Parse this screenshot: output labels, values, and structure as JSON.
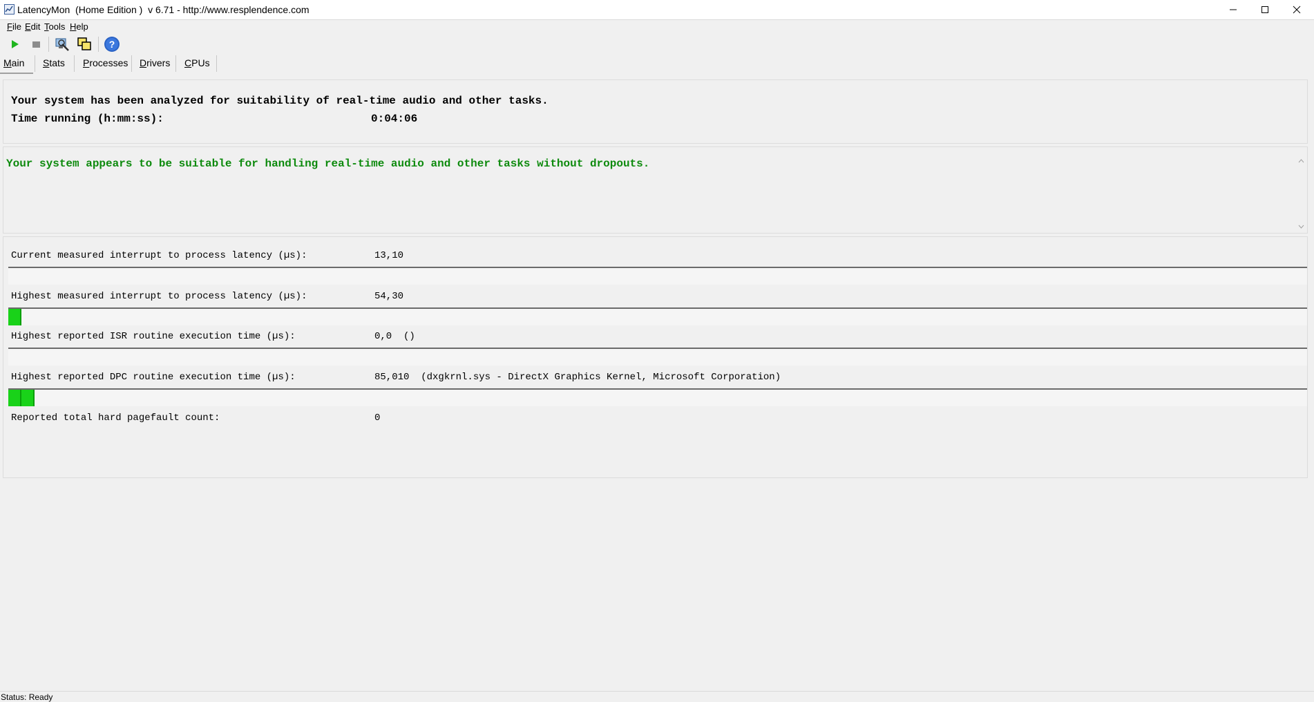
{
  "window": {
    "title": "LatencyMon  (Home Edition )  v 6.71 - http://www.resplendence.com"
  },
  "menu": [
    {
      "underline": "F",
      "rest": "ile"
    },
    {
      "underline": "E",
      "rest": "dit"
    },
    {
      "underline": "T",
      "rest": "ools"
    },
    {
      "underline": "H",
      "rest": "elp"
    }
  ],
  "toolbar": {
    "icons": [
      "play-icon",
      "stop-icon",
      "analyze-icon",
      "copy-windows-icon",
      "help-icon"
    ]
  },
  "tabs": [
    {
      "underline": "M",
      "rest": "ain"
    },
    {
      "underline": "S",
      "rest": "tats"
    },
    {
      "underline": "P",
      "rest": "rocesses"
    },
    {
      "underline": "D",
      "rest": "rivers"
    },
    {
      "underline": "C",
      "rest": "PUs"
    }
  ],
  "summary": {
    "headline": "Your system has been analyzed for suitability of real-time audio and other tasks.",
    "time_label": "Time running (h:mm:ss):",
    "time_value": "0:04:06"
  },
  "verdict": {
    "text": "Your system appears to be suitable for handling real-time audio and other tasks without dropouts."
  },
  "metrics": {
    "current_latency": {
      "label": "Current measured interrupt to process latency (µs):",
      "value": "13,10",
      "bar_fraction": 0
    },
    "highest_latency": {
      "label": "Highest measured interrupt to process latency (µs):",
      "value": "54,30",
      "bar_fraction": 0.01
    },
    "isr": {
      "label": "Highest reported ISR routine execution time (µs):",
      "value": "0,0  ()",
      "bar_fraction": 0
    },
    "dpc": {
      "label": "Highest reported DPC routine execution time (µs):",
      "value": "85,010  (dxgkrnl.sys - DirectX Graphics Kernel, Microsoft Corporation)",
      "bar_fraction": 0.02
    },
    "pagefault": {
      "label": "Reported total hard pagefault count:",
      "value": "0"
    }
  },
  "status": {
    "text": "Status: Ready"
  },
  "colors": {
    "meter_green": "#19d219",
    "verdict_green": "#0d8a0d"
  }
}
